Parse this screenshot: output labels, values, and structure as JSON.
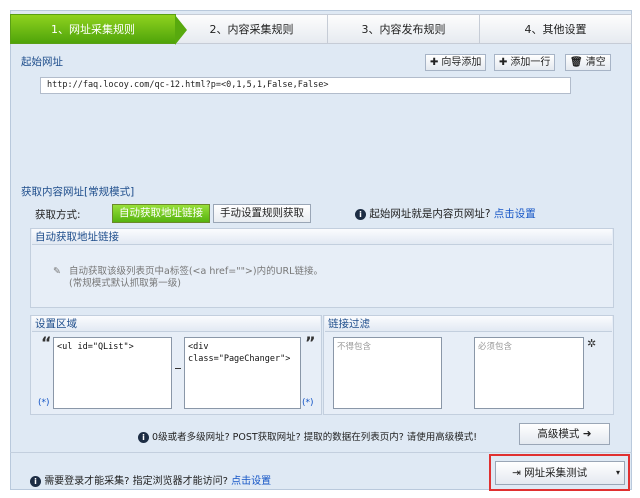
{
  "steps": [
    {
      "label": "1、网址采集规则"
    },
    {
      "label": "2、内容采集规则"
    },
    {
      "label": "3、内容发布规则"
    },
    {
      "label": "4、其他设置"
    }
  ],
  "start_url": {
    "label": "起始网址",
    "add_wizard": "向导添加",
    "add_line": "添加一行",
    "clear": "清空",
    "value": "http://faq.locoy.com/qc-12.html?p=<0,1,5,1,False,False>"
  },
  "content_url": {
    "label": "获取内容网址",
    "mode": "[常规模式]",
    "method_label": "获取方式:",
    "auto_btn": "自动获取地址链接",
    "manual_btn": "手动设置规则获取",
    "start_is_content": "起始网址就是内容页网址?",
    "set_link": "点击设置"
  },
  "auto_link": {
    "header": "自动获取地址链接",
    "desc_line1": "自动获取该级列表页中a标签(<a href=\"\">)内的URL链接。",
    "desc_line2": "(常规模式默认抓取第一级)"
  },
  "settings": {
    "header": "设置区域",
    "start_value": "<ul id=\"QList\">",
    "end_value": "<div class=\"PageChanger\">",
    "star_left": "(*)",
    "star_right": "(*)"
  },
  "filter": {
    "header": "链接过滤",
    "exclude_placeholder": "不得包含",
    "include_placeholder": "必须包含"
  },
  "advanced": {
    "hint": "0级或者多级网址? POST获取网址? 提取的数据在列表页内? 请使用高级模式!",
    "button": "高级模式"
  },
  "footer": {
    "login_hint": "需要登录才能采集? 指定浏览器才能访问?",
    "set_link": "点击设置",
    "test_button": "网址采集测试"
  }
}
